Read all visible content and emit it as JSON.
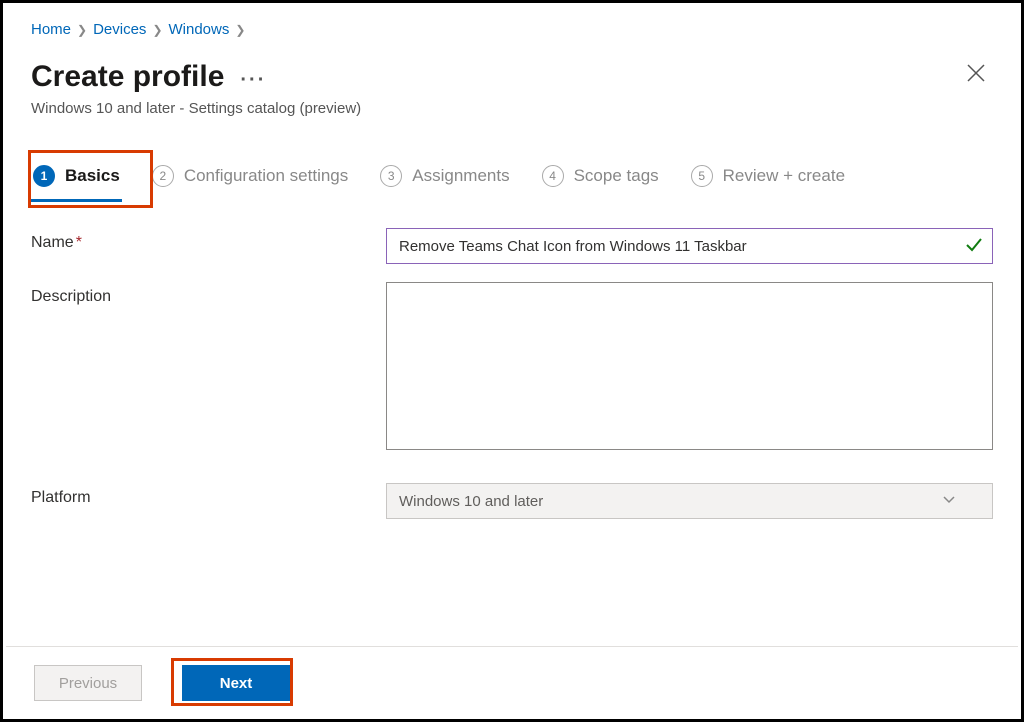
{
  "breadcrumb": {
    "items": [
      "Home",
      "Devices",
      "Windows"
    ]
  },
  "header": {
    "title": "Create profile",
    "subtitle": "Windows 10 and later - Settings catalog (preview)"
  },
  "wizard": {
    "steps": [
      {
        "num": "1",
        "label": "Basics",
        "active": true
      },
      {
        "num": "2",
        "label": "Configuration settings",
        "active": false
      },
      {
        "num": "3",
        "label": "Assignments",
        "active": false
      },
      {
        "num": "4",
        "label": "Scope tags",
        "active": false
      },
      {
        "num": "5",
        "label": "Review + create",
        "active": false
      }
    ]
  },
  "form": {
    "name_label": "Name",
    "name_value": "Remove Teams Chat Icon from Windows 11 Taskbar",
    "description_label": "Description",
    "description_value": "",
    "platform_label": "Platform",
    "platform_value": "Windows 10 and later"
  },
  "footer": {
    "previous": "Previous",
    "next": "Next"
  }
}
